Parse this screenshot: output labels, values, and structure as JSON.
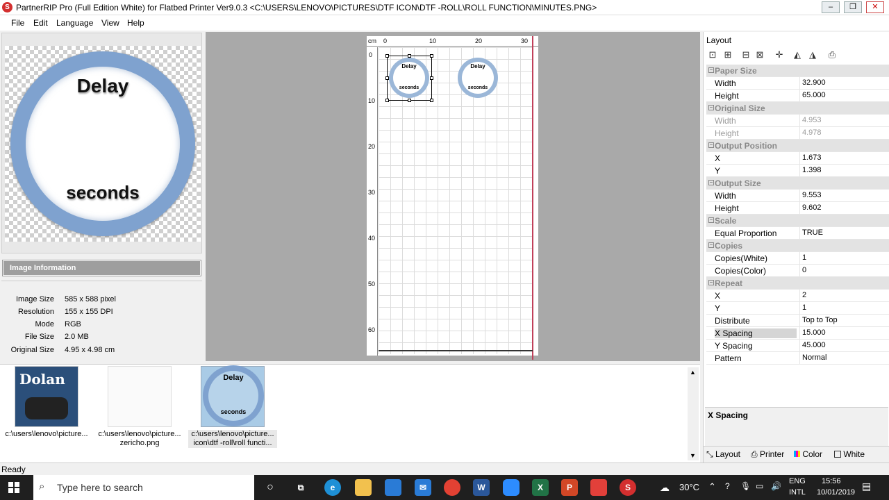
{
  "window": {
    "title": "PartnerRIP Pro (Full Edition White) for Flatbed Printer Ver9.0.3 <C:\\USERS\\LENOVO\\PICTURES\\DTF ICON\\DTF -ROLL\\ROLL FUNCTION\\MINUTES.PNG>",
    "app_icon_glyph": "S",
    "minimize": "–",
    "maximize": "❐",
    "close": "✕"
  },
  "menu": [
    "File",
    "Edit",
    "Language",
    "View",
    "Help"
  ],
  "preview": {
    "text_top": "Delay",
    "text_bottom": "seconds"
  },
  "image_info": {
    "header": "Image Information",
    "rows": [
      {
        "label": "Image Size",
        "value": "585 x 588 pixel"
      },
      {
        "label": "Resolution",
        "value": "155 x 155 DPI"
      },
      {
        "label": "Mode",
        "value": "RGB"
      },
      {
        "label": "File Size",
        "value": "2.0 MB"
      },
      {
        "label": "Original Size",
        "value": "4.95 x 4.98 cm"
      }
    ]
  },
  "workspace": {
    "ruler_unit": "cm",
    "ruler_top": [
      "0",
      "10",
      "20",
      "30"
    ],
    "ruler_left": [
      "0",
      "10",
      "20",
      "30",
      "40",
      "50",
      "60"
    ],
    "item_text_top": "Delay",
    "item_text_bottom": "seconds"
  },
  "layout_panel": {
    "title": "Layout",
    "tools": [
      "⊡",
      "⊞",
      "⊟",
      "⊠",
      "✛",
      "◭",
      "◮",
      "⎙"
    ],
    "groups": [
      {
        "name": "Paper Size",
        "props": [
          {
            "name": "Width",
            "value": "32.900"
          },
          {
            "name": "Height",
            "value": "65.000"
          }
        ]
      },
      {
        "name": "Original Size",
        "dim": true,
        "props": [
          {
            "name": "Width",
            "value": "4.953"
          },
          {
            "name": "Height",
            "value": "4.978"
          }
        ]
      },
      {
        "name": "Output Position",
        "props": [
          {
            "name": "X",
            "value": "1.673"
          },
          {
            "name": "Y",
            "value": "1.398"
          }
        ]
      },
      {
        "name": "Output Size",
        "props": [
          {
            "name": "Width",
            "value": "9.553"
          },
          {
            "name": "Height",
            "value": "9.602"
          }
        ]
      },
      {
        "name": "Scale",
        "props": [
          {
            "name": "Equal Proportion",
            "value": "TRUE"
          }
        ]
      },
      {
        "name": "Copies",
        "props": [
          {
            "name": "Copies(White)",
            "value": "1"
          },
          {
            "name": "Copies(Color)",
            "value": "0"
          }
        ]
      },
      {
        "name": "Repeat",
        "props": [
          {
            "name": "X",
            "value": "2"
          },
          {
            "name": "Y",
            "value": "1"
          },
          {
            "name": "Distribute",
            "value": "Top to Top"
          },
          {
            "name": "X Spacing",
            "value": "15.000",
            "selected": true
          },
          {
            "name": "Y Spacing",
            "value": "45.000"
          },
          {
            "name": "Pattern",
            "value": "Normal"
          }
        ]
      }
    ],
    "description_title": "X Spacing",
    "tabs": [
      "Layout",
      "Printer",
      "Color",
      "White"
    ]
  },
  "thumbnails": [
    {
      "caption": "c:\\users\\lenovo\\picture...",
      "caption2": "",
      "art": "Dolan"
    },
    {
      "caption": "c:\\users\\lenovo\\picture...",
      "caption2": "zericho.png",
      "art": ""
    },
    {
      "caption": "c:\\users\\lenovo\\picture...",
      "caption2": "icon\\dtf -roll\\roll functi...",
      "art_top": "Delay",
      "art_bottom": "seconds"
    }
  ],
  "status": "Ready",
  "taskbar": {
    "search_placeholder": "Type here to search",
    "weather": "30°C",
    "lang1": "ENG",
    "lang2": "INTL",
    "time": "15:56",
    "date": "10/01/2019"
  }
}
